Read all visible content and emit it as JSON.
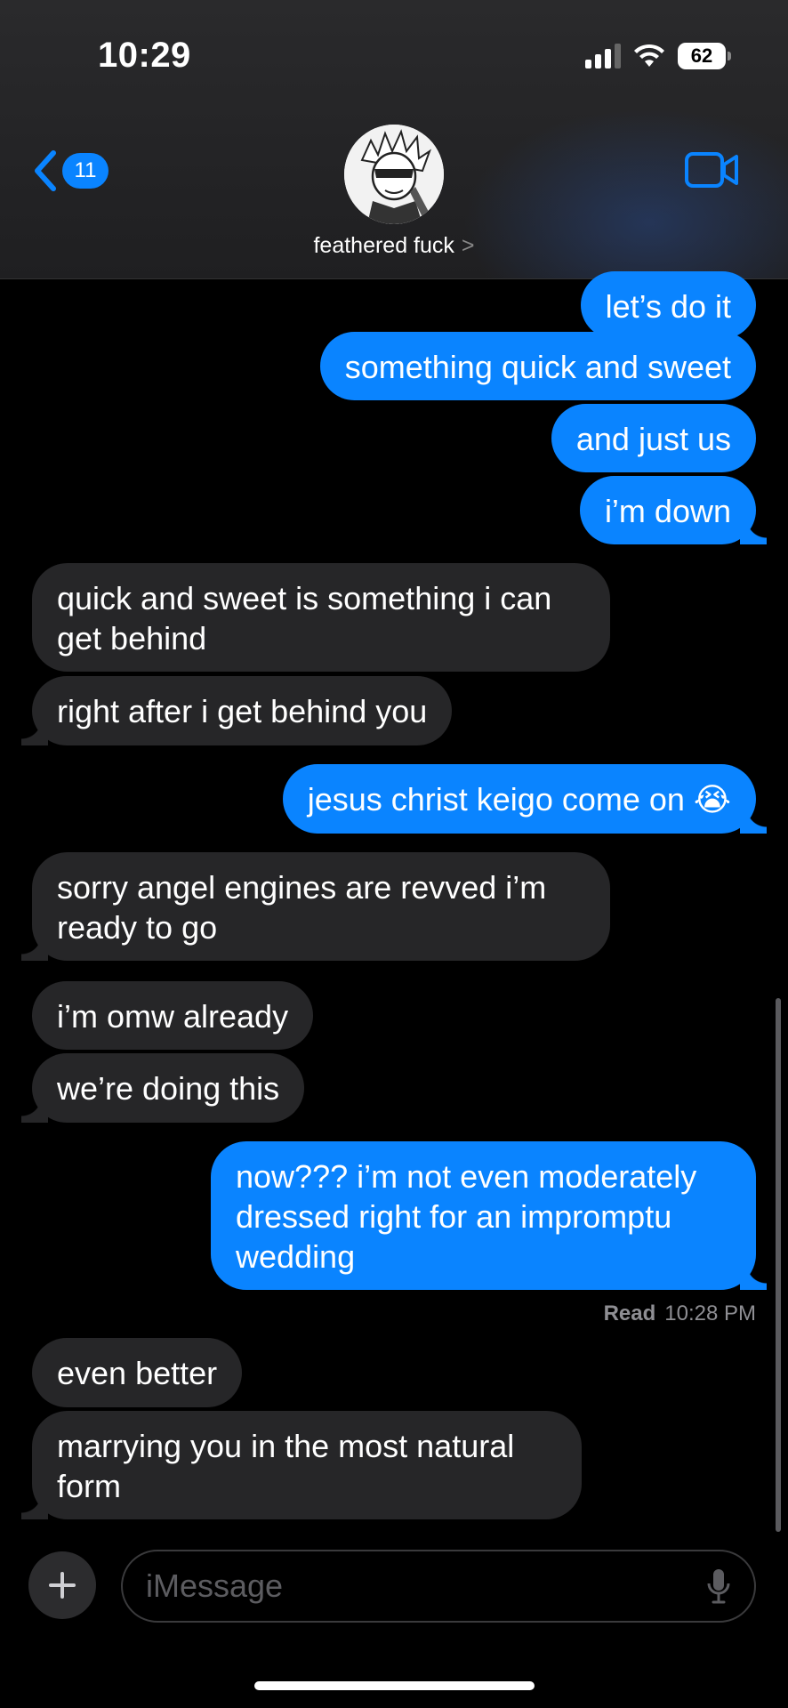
{
  "status_bar": {
    "time": "10:29",
    "battery": "62"
  },
  "header": {
    "back_count": "11",
    "contact_name": "feathered fuck",
    "contact_chevron": ">"
  },
  "messages": [
    {
      "dir": "out",
      "text": "let’s do it"
    },
    {
      "dir": "out",
      "text": "something quick and sweet"
    },
    {
      "dir": "out",
      "text": "and just us"
    },
    {
      "dir": "out",
      "text": "i’m down"
    },
    {
      "dir": "in",
      "text": "quick and sweet is something i can get behind"
    },
    {
      "dir": "in",
      "text": "right after i get behind you"
    },
    {
      "dir": "out",
      "text": "jesus christ keigo come on 😭"
    },
    {
      "dir": "in",
      "text": "sorry angel engines are revved i’m ready to go"
    },
    {
      "dir": "in",
      "text": "i’m omw already"
    },
    {
      "dir": "in",
      "text": "we’re doing this"
    },
    {
      "dir": "out",
      "text": "now??? i’m not even moderately dressed right for an impromptu wedding"
    },
    {
      "dir": "in",
      "text": "even better"
    },
    {
      "dir": "in",
      "text": "marrying you in the most natural form"
    }
  ],
  "receipt": {
    "label": "Read",
    "time": "10:28 PM"
  },
  "composer": {
    "placeholder": "iMessage"
  },
  "colors": {
    "outgoing": "#0a84ff",
    "incoming": "#262628",
    "accent": "#0a84ff"
  },
  "icons": [
    "back-chevron-icon",
    "video-camera-icon",
    "plus-icon",
    "microphone-icon",
    "wifi-icon",
    "cellular-signal-icon",
    "battery-icon"
  ]
}
